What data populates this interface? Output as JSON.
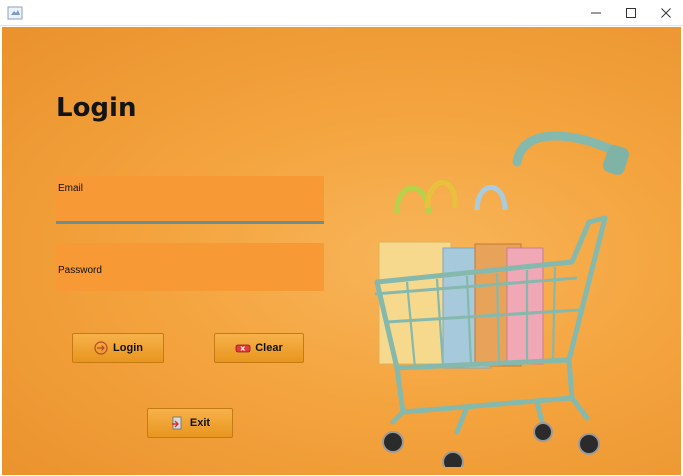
{
  "window": {
    "controls": {
      "minimize": "minimize-icon",
      "maximize": "maximize-icon",
      "close": "close-icon"
    }
  },
  "login": {
    "title": "Login",
    "email_label": "Email",
    "password_label": "Password",
    "email_value": "",
    "password_value": ""
  },
  "buttons": {
    "login_label": "Login",
    "clear_label": "Clear",
    "exit_label": "Exit"
  },
  "icons": {
    "login": "login-arrow-icon",
    "clear": "clear-eraser-icon",
    "exit": "exit-icon",
    "illustration": "shopping-cart-with-bags"
  },
  "colors": {
    "background": "#f4a43e",
    "field": "#f79934",
    "button": "#f0a336",
    "cart": "#8fbfb2"
  }
}
